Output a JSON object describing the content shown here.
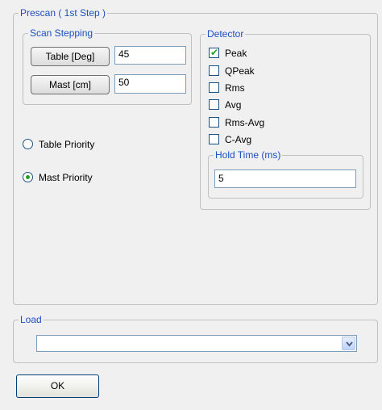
{
  "prescan": {
    "title": "Prescan ( 1st Step )",
    "scan_stepping": {
      "title": "Scan Stepping",
      "table_button": "Table [Deg]",
      "table_value": "45",
      "mast_button": "Mast [cm]",
      "mast_value": "50"
    },
    "priority": {
      "options": [
        {
          "label": "Table Priority",
          "selected": false
        },
        {
          "label": "Mast Priority",
          "selected": true
        }
      ]
    },
    "detector": {
      "title": "Detector",
      "options": [
        {
          "label": "Peak",
          "checked": true
        },
        {
          "label": "QPeak",
          "checked": false
        },
        {
          "label": "Rms",
          "checked": false
        },
        {
          "label": "Avg",
          "checked": false
        },
        {
          "label": "Rms-Avg",
          "checked": false
        },
        {
          "label": "C-Avg",
          "checked": false
        }
      ],
      "hold_time": {
        "title": "Hold Time (ms)",
        "value": "5"
      }
    }
  },
  "load": {
    "title": "Load",
    "selected_value": ""
  },
  "ok_button": "OK",
  "colors": {
    "legend_text": "#1c4fbf",
    "check_mark": "#21a121",
    "background": "#f0f0f0"
  },
  "icons": {
    "check": "check-icon",
    "dropdown": "chevron-down-icon"
  }
}
